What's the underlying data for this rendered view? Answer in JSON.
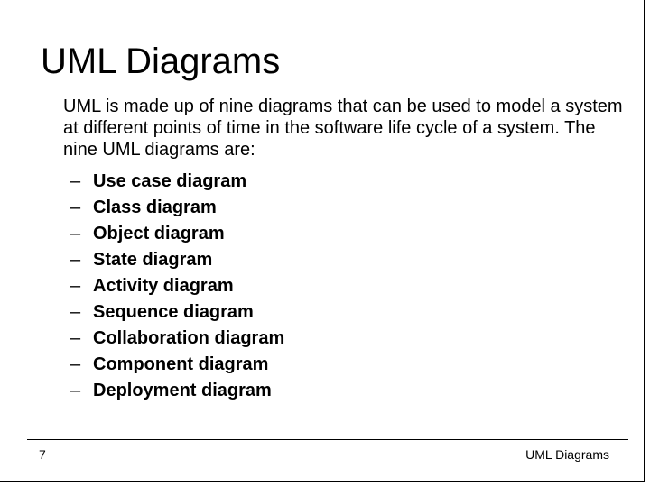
{
  "slide": {
    "title": "UML Diagrams",
    "intro": "UML is made up of nine diagrams that can be used to model a system at different points of time in the software life cycle of a system. The nine UML diagrams are:",
    "bullet_marker": "–",
    "items": [
      {
        "label": "Use case diagram"
      },
      {
        "label": "Class diagram"
      },
      {
        "label": "Object diagram"
      },
      {
        "label": "State diagram"
      },
      {
        "label": "Activity diagram"
      },
      {
        "label": "Sequence diagram"
      },
      {
        "label": "Collaboration diagram"
      },
      {
        "label": "Component diagram"
      },
      {
        "label": "Deployment diagram"
      }
    ]
  },
  "footer": {
    "page_number": "7",
    "title": "UML Diagrams"
  }
}
